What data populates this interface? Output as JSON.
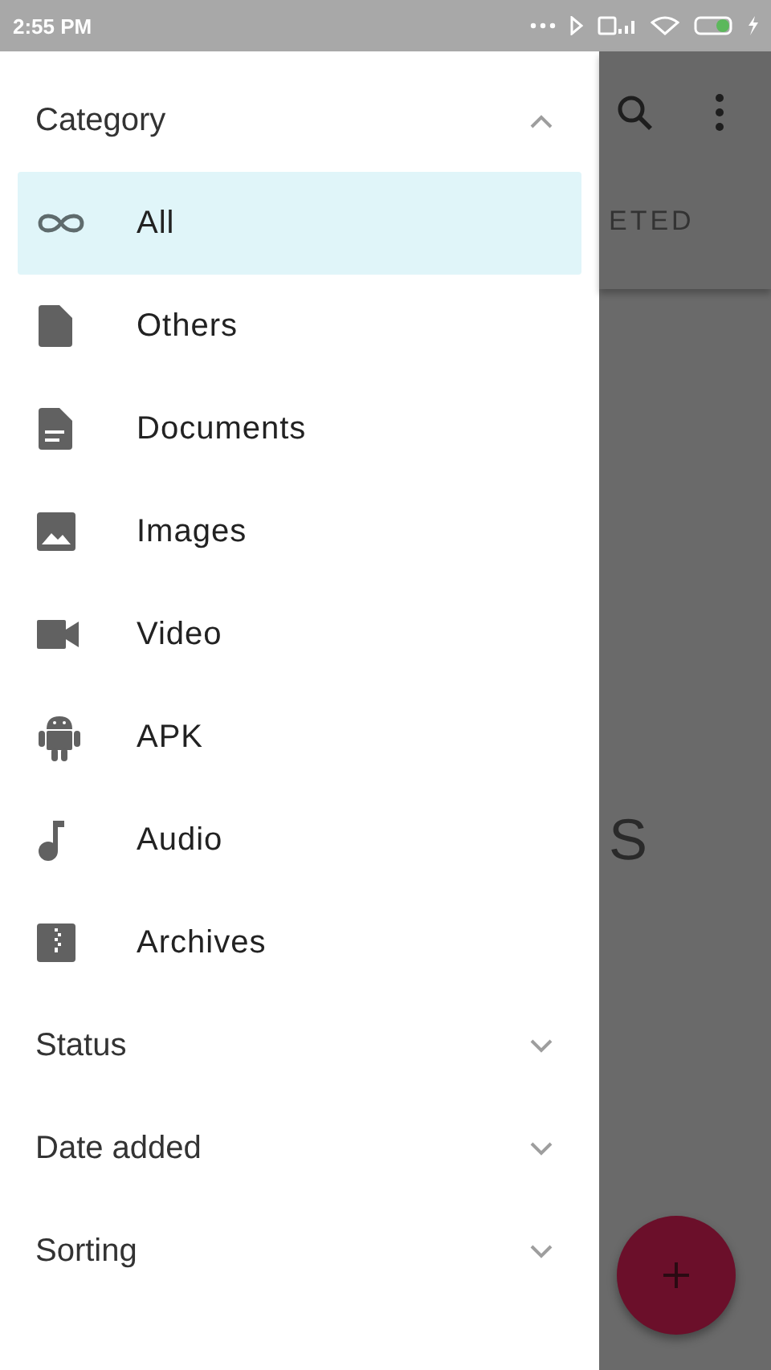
{
  "status_bar": {
    "time": "2:55 PM"
  },
  "drawer": {
    "sections": [
      {
        "title": "Category",
        "expanded": true,
        "items": [
          {
            "label": "All",
            "kind": "all",
            "selected": true
          },
          {
            "label": "Others",
            "kind": "file",
            "selected": false
          },
          {
            "label": "Documents",
            "kind": "document",
            "selected": false
          },
          {
            "label": "Images",
            "kind": "image",
            "selected": false
          },
          {
            "label": "Video",
            "kind": "video",
            "selected": false
          },
          {
            "label": "APK",
            "kind": "android",
            "selected": false
          },
          {
            "label": "Audio",
            "kind": "audio",
            "selected": false
          },
          {
            "label": "Archives",
            "kind": "archive",
            "selected": false
          }
        ]
      },
      {
        "title": "Status",
        "expanded": false
      },
      {
        "title": "Date added",
        "expanded": false
      },
      {
        "title": "Sorting",
        "expanded": false
      }
    ]
  },
  "background": {
    "tab": "ETED",
    "body_text": "S"
  }
}
